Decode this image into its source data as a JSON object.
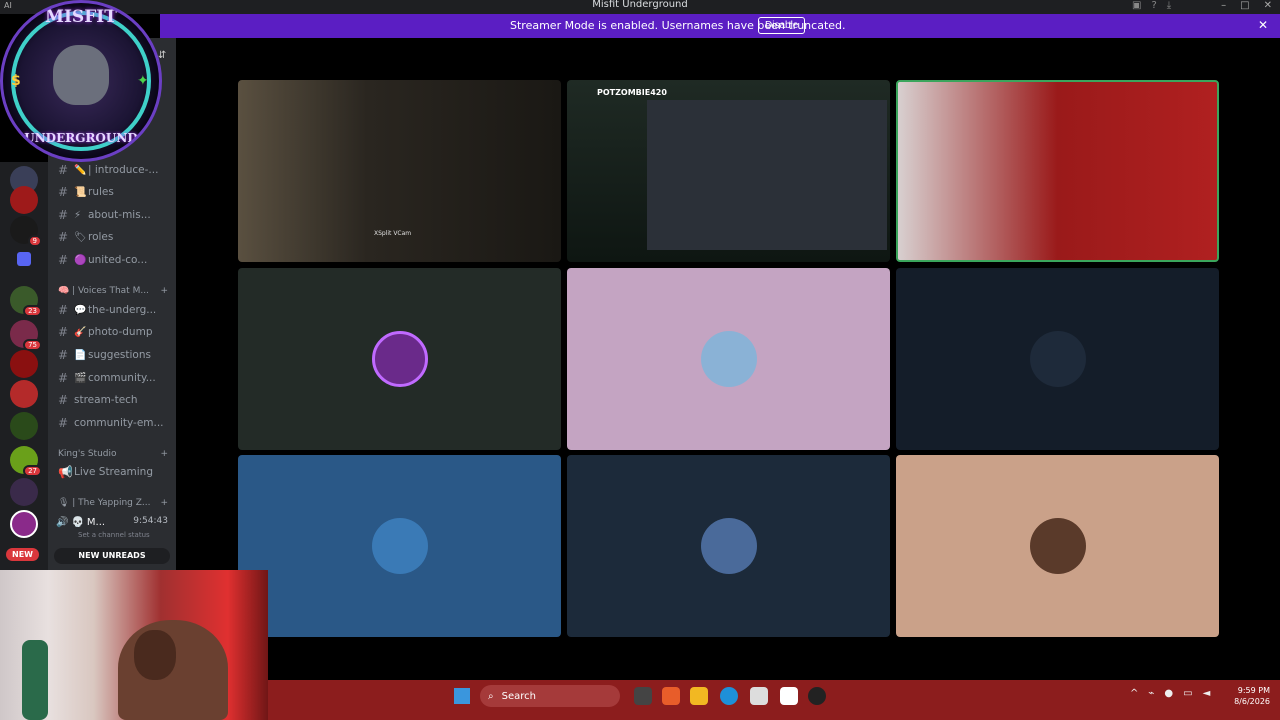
{
  "window": {
    "title": "Misfit Underground",
    "corner_text": "AI"
  },
  "banner": {
    "message": "Streamer Mode is enabled. Usernames have been truncated.",
    "disable_label": "Disable",
    "close_glyph": "✕",
    "color": "#5b1ec3"
  },
  "server_logo": {
    "line1": "MISFIT",
    "line2": "UNDERGROUND"
  },
  "server_rail": {
    "badges": [
      "9",
      "23",
      "75",
      "27"
    ],
    "new_label": "NEW"
  },
  "channels": {
    "items": [
      {
        "prefix": "#",
        "emoji": "✏️",
        "name": "| introduce-..."
      },
      {
        "prefix": "#",
        "emoji": "📜",
        "name": "rules"
      },
      {
        "prefix": "#",
        "emoji": "⚡",
        "name": "about-mis..."
      },
      {
        "prefix": "#",
        "emoji": "🏷",
        "name": "roles"
      },
      {
        "prefix": "#",
        "emoji": "🟣",
        "name": "united-co..."
      }
    ],
    "category1": {
      "name": "🧠 | Voices That M...",
      "add": "+"
    },
    "items2": [
      {
        "prefix": "#",
        "emoji": "💬",
        "name": "the-underg..."
      },
      {
        "prefix": "#",
        "emoji": "🎸",
        "name": "photo-dump"
      },
      {
        "prefix": "#",
        "emoji": "📄",
        "name": "suggestions"
      },
      {
        "prefix": "#",
        "emoji": "🎬",
        "name": "community..."
      },
      {
        "prefix": "#",
        "emoji": "",
        "name": "stream-tech"
      },
      {
        "prefix": "#",
        "emoji": "",
        "name": "community-em..."
      }
    ],
    "category2": {
      "name": "King's Studio",
      "add": "+"
    },
    "live_streaming": "Live Streaming",
    "category3": {
      "name": "🎙 | The Yapping Z...",
      "add": "+"
    },
    "voice_user": {
      "name": "M...",
      "time": "9:54:43",
      "status": "Set a channel status"
    },
    "new_unreads": "NEW UNREADS"
  },
  "tiles": [
    {
      "kind": "camera",
      "label": "XSplit VCam",
      "bg": "#2a2620"
    },
    {
      "kind": "screen",
      "label": "POTZOMBIE420",
      "bg": "#1a2a22"
    },
    {
      "kind": "camera",
      "bg": "#8a1c1c",
      "speaking": true
    },
    {
      "kind": "avatar",
      "bg": "#232b27",
      "avatar_color": "#6a2a8a"
    },
    {
      "kind": "avatar",
      "bg": "#c4a4c2",
      "avatar_color": "#8ab2d6"
    },
    {
      "kind": "avatar",
      "bg": "#141d29",
      "avatar_color": "#1e2a3a"
    },
    {
      "kind": "avatar",
      "bg": "#2a5887",
      "avatar_color": "#3a7ab6"
    },
    {
      "kind": "avatar",
      "bg": "#1c2a3a",
      "avatar_color": "#4a6a9a"
    },
    {
      "kind": "avatar",
      "bg": "#caa189",
      "avatar_color": "#5a3a2a"
    }
  ],
  "taskbar": {
    "search_label": "Search",
    "time": "9:59 PM",
    "date": "8/6/2026",
    "color": "#8c1d1d"
  }
}
